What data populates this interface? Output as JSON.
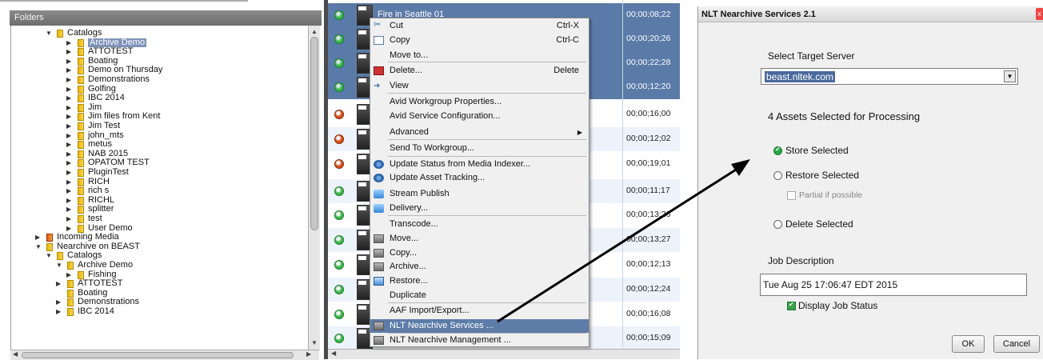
{
  "folders": {
    "header": "Folders",
    "items": [
      {
        "label": "Catalogs",
        "toggle": "▼"
      },
      {
        "label": "Archive Demo",
        "toggle": "▶",
        "selected": true
      },
      {
        "label": "ATTOTEST",
        "toggle": "▶"
      },
      {
        "label": "Boating",
        "toggle": "▶"
      },
      {
        "label": "Demo on Thursday",
        "toggle": "▶"
      },
      {
        "label": "Demonstrations",
        "toggle": "▶"
      },
      {
        "label": "Golfing",
        "toggle": "▶"
      },
      {
        "label": "IBC 2014",
        "toggle": "▶"
      },
      {
        "label": "Jim",
        "toggle": "▶"
      },
      {
        "label": "Jim files from Kent",
        "toggle": "▶"
      },
      {
        "label": "Jim Test",
        "toggle": "▶"
      },
      {
        "label": "john_mts",
        "toggle": "▶"
      },
      {
        "label": "metus",
        "toggle": "▶"
      },
      {
        "label": "NAB 2015",
        "toggle": "▶"
      },
      {
        "label": "OPATOM TEST",
        "toggle": "▶"
      },
      {
        "label": "PluginTest",
        "toggle": "▶"
      },
      {
        "label": "RICH",
        "toggle": "▶"
      },
      {
        "label": "rich s",
        "toggle": "▶"
      },
      {
        "label": "RICHL",
        "toggle": "▶"
      },
      {
        "label": "splitter",
        "toggle": "▶"
      },
      {
        "label": "test",
        "toggle": "▶"
      },
      {
        "label": "User Demo",
        "toggle": "▶"
      },
      {
        "label": "Incoming Media",
        "toggle": "▶"
      },
      {
        "label": "Nearchive on BEAST",
        "toggle": "▼"
      },
      {
        "label": "Catalogs",
        "toggle": "▼"
      },
      {
        "label": "Archive Demo",
        "toggle": "▼"
      },
      {
        "label": "Fishing",
        "toggle": "▶"
      },
      {
        "label": "ATTOTEST",
        "toggle": "▶"
      },
      {
        "label": "Boating",
        "toggle": ""
      },
      {
        "label": "Demonstrations",
        "toggle": "▶"
      },
      {
        "label": "IBC 2014",
        "toggle": "▶"
      }
    ]
  },
  "assets": {
    "rows": [
      {
        "name": "Fire in Seattle 01",
        "timecode": "00;00;08;22",
        "status": "green",
        "selected": true
      },
      {
        "name": "",
        "timecode": "00;00;20;26",
        "status": "green",
        "selected": true
      },
      {
        "name": "",
        "timecode": "00;00;22;28",
        "status": "green",
        "selected": true
      },
      {
        "name": "",
        "timecode": "00;00;12;20",
        "status": "green",
        "selected": true
      },
      {
        "name": "",
        "timecode": "00;00;16;00",
        "status": "red",
        "selected": false
      },
      {
        "name": "",
        "timecode": "00;00;12;02",
        "status": "red",
        "selected": false
      },
      {
        "name": "",
        "timecode": "00;00;19;01",
        "status": "red",
        "selected": false
      },
      {
        "name": "",
        "timecode": "00;00;11;17",
        "status": "green",
        "selected": false
      },
      {
        "name": "",
        "timecode": "00;00;13;26",
        "status": "green",
        "selected": false
      },
      {
        "name": "",
        "timecode": "00;00;13;27",
        "status": "green",
        "selected": false
      },
      {
        "name": "",
        "timecode": "00;00;12;13",
        "status": "green",
        "selected": false
      },
      {
        "name": "",
        "timecode": "00;00;12;24",
        "status": "green",
        "selected": false
      },
      {
        "name": "",
        "timecode": "00;00;16;08",
        "status": "green",
        "selected": false
      },
      {
        "name": "",
        "timecode": "00;00;15;09",
        "status": "green",
        "selected": false
      }
    ]
  },
  "context_menu": {
    "items": [
      {
        "label": "Cut",
        "shortcut": "Ctrl-X",
        "icon": "scissors-icon"
      },
      {
        "label": "Copy",
        "shortcut": "Ctrl-C",
        "icon": "copy-icon"
      },
      {
        "label": "Move to...",
        "shortcut": "",
        "icon": ""
      },
      {
        "label": "Delete...",
        "shortcut": "Delete",
        "icon": "delete-icon"
      },
      {
        "label": "View",
        "shortcut": "",
        "icon": "view-icon"
      },
      {
        "label": "Avid Workgroup Properties...",
        "shortcut": "",
        "icon": ""
      },
      {
        "label": "Avid Service Configuration...",
        "shortcut": "",
        "icon": ""
      },
      {
        "label": "Advanced",
        "shortcut": "",
        "icon": "",
        "submenu": "▶"
      },
      {
        "label": "Send To Workgroup...",
        "shortcut": "",
        "icon": ""
      },
      {
        "label": "Update Status from Media Indexer...",
        "shortcut": "",
        "icon": "gear-icon"
      },
      {
        "label": "Update Asset Tracking...",
        "shortcut": "",
        "icon": "gear-icon"
      },
      {
        "label": "Stream Publish",
        "shortcut": "",
        "icon": "stream-icon"
      },
      {
        "label": "Delivery...",
        "shortcut": "",
        "icon": "delivery-icon"
      },
      {
        "label": "Transcode...",
        "shortcut": "",
        "icon": ""
      },
      {
        "label": "Move...",
        "shortcut": "",
        "icon": "box-icon"
      },
      {
        "label": "Copy...",
        "shortcut": "",
        "icon": "box-icon"
      },
      {
        "label": "Archive...",
        "shortcut": "",
        "icon": "box-icon"
      },
      {
        "label": "Restore...",
        "shortcut": "",
        "icon": "restore-icon"
      },
      {
        "label": "Duplicate",
        "shortcut": "",
        "icon": ""
      },
      {
        "label": "AAF Import/Export...",
        "shortcut": "",
        "icon": ""
      },
      {
        "label": "NLT Nearchive Services ...",
        "shortcut": "",
        "icon": "box-icon",
        "highlighted": true
      },
      {
        "label": "NLT Nearchive Management ...",
        "shortcut": "",
        "icon": "box-icon"
      }
    ]
  },
  "dialog": {
    "title": "NLT Nearchive Services 2.1",
    "close_label": "x",
    "target_server_label": "Select Target Server",
    "target_server_value": "beast.nltek.com",
    "assets_selected_text": "4 Assets Selected for Processing",
    "options": {
      "store": "Store Selected",
      "restore": "Restore Selected",
      "partial": "Partial if possible",
      "delete": "Delete Selected"
    },
    "job_description_label": "Job Description",
    "job_description_value": "Tue Aug 25 17:06:47 EDT 2015",
    "display_job_status": "Display Job Status",
    "ok_label": "OK",
    "cancel_label": "Cancel"
  },
  "colors": {
    "selection": "#5a7aa8",
    "menu_highlight": "#5d7ca8",
    "status_green": "#3cba4c",
    "status_red": "#d8521e"
  }
}
